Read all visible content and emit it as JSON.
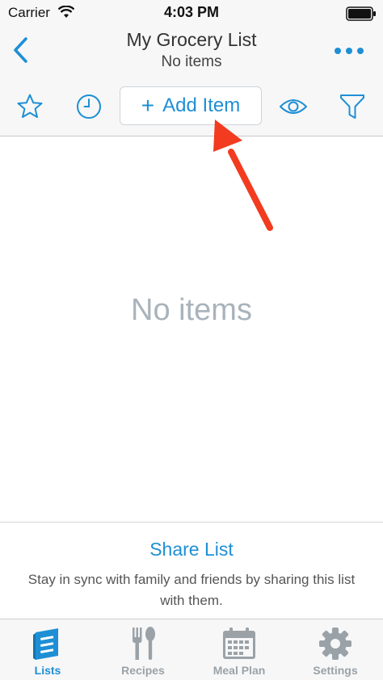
{
  "status_bar": {
    "carrier": "Carrier",
    "time": "4:03 PM"
  },
  "nav": {
    "title": "My Grocery List",
    "subtitle": "No items"
  },
  "toolbar": {
    "add_item_label": "Add Item",
    "plus_glyph": "+"
  },
  "main": {
    "empty_text": "No items"
  },
  "share": {
    "title": "Share List",
    "description": "Stay in sync with family and friends by sharing this list with them."
  },
  "tabs": [
    {
      "label": "Lists",
      "icon": "lists-icon",
      "active": true
    },
    {
      "label": "Recipes",
      "icon": "fork-spoon-icon",
      "active": false
    },
    {
      "label": "Meal Plan",
      "icon": "calendar-icon",
      "active": false
    },
    {
      "label": "Settings",
      "icon": "gear-icon",
      "active": false
    }
  ],
  "colors": {
    "accent": "#1e8fd5",
    "muted": "#9aa2a8",
    "empty_text": "#a9b3bb",
    "arrow": "#f23b1f"
  }
}
